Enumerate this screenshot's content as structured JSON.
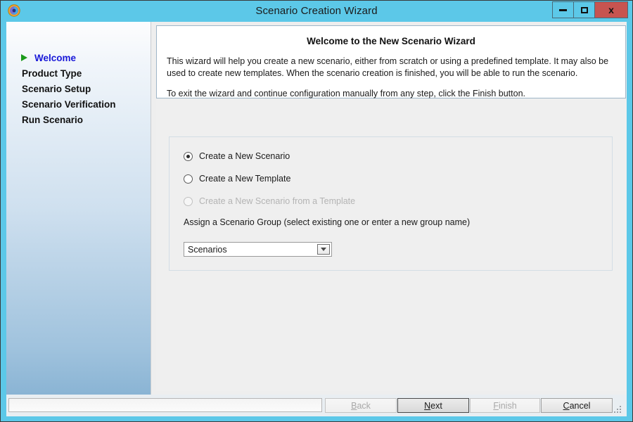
{
  "window": {
    "title": "Scenario Creation Wizard",
    "app_icon": "swirl-app-icon",
    "controls": {
      "minimize": "minimize-icon",
      "maximize": "maximize-icon",
      "close": "x"
    },
    "colors": {
      "titlebar": "#5cc8e8",
      "close_button": "#c75450",
      "active_step": "#1818d8",
      "step_marker": "#1a9a1a"
    }
  },
  "sidebar": {
    "items": [
      {
        "label": "Welcome",
        "active": true,
        "marker": "green-arrow-icon"
      },
      {
        "label": "Product Type",
        "active": false
      },
      {
        "label": "Scenario Setup",
        "active": false
      },
      {
        "label": "Scenario Verification",
        "active": false
      },
      {
        "label": "Run Scenario",
        "active": false
      }
    ]
  },
  "header": {
    "title": "Welcome to the New Scenario Wizard",
    "paragraph1": "This wizard will help you create a new scenario, either from scratch or using a predefined template. It may also be used to create new templates. When the scenario creation is finished, you will be able to run the scenario.",
    "paragraph2": "To exit the wizard and continue configuration manually from any step, click the Finish button."
  },
  "options": {
    "radios": [
      {
        "label": "Create a New Scenario",
        "checked": true,
        "disabled": false
      },
      {
        "label": "Create a New Template",
        "checked": false,
        "disabled": false
      },
      {
        "label": "Create a New Scenario from a Template",
        "checked": false,
        "disabled": true
      }
    ],
    "group_caption": "Assign a Scenario Group (select existing one or enter a new group name)",
    "combo": {
      "value": "Scenarios",
      "placeholder": "Scenarios",
      "arrow": "chevron-down-icon"
    }
  },
  "footer": {
    "status_text": "",
    "buttons": {
      "back": {
        "accel": "B",
        "rest": "ack",
        "disabled": true,
        "focused": false
      },
      "next": {
        "accel": "N",
        "rest": "ext",
        "disabled": false,
        "focused": true
      },
      "finish": {
        "accel": "F",
        "rest": "inish",
        "disabled": true,
        "focused": false
      },
      "cancel": {
        "accel": "C",
        "rest": "ancel",
        "disabled": false,
        "focused": false
      }
    },
    "grip": "resize-grip-icon"
  }
}
